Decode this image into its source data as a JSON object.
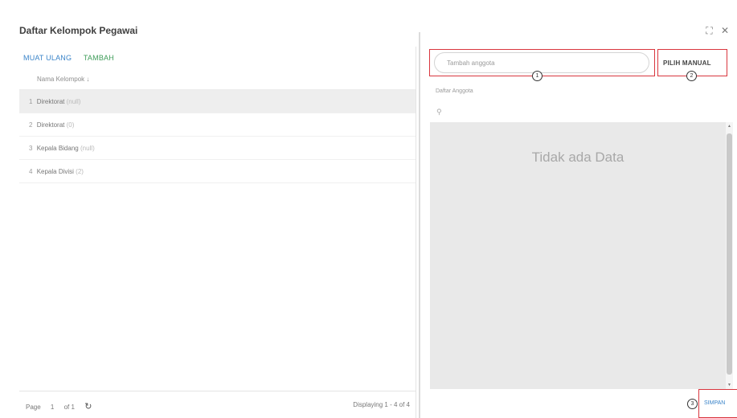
{
  "window": {
    "title": "Daftar Kelompok Pegawai",
    "icons": [
      "maximize-icon",
      "close-icon"
    ],
    "maximize_glyph": "⛶",
    "close_glyph": "✕"
  },
  "left": {
    "toolbar": {
      "reload_label": "MUAT ULANG",
      "add_label": "TAMBAH"
    },
    "column_header": "Nama Kelompok ↓",
    "rows": [
      {
        "index": "1",
        "name": "Direktorat",
        "count": "(null)",
        "selected": true
      },
      {
        "index": "2",
        "name": "Direktorat",
        "count": "(0)",
        "selected": false
      },
      {
        "index": "3",
        "name": "Kepala Bidang",
        "count": "(null)",
        "selected": false
      },
      {
        "index": "4",
        "name": "Kepala Divisi",
        "count": "(2)",
        "selected": false
      }
    ],
    "footer": {
      "page_label": "Page",
      "page_value": "1",
      "of_label": "of 1",
      "refresh_glyph": "↻",
      "displaying": "Displaying 1 - 4 of 4"
    }
  },
  "right": {
    "search_placeholder": "Tambah anggota",
    "pilih_manual_label": "PILIH MANUAL",
    "daftar_label": "Daftar Anggota",
    "search_glyph": "⚲",
    "empty_text": "Tidak ada Data",
    "save_label": "SIMPAN"
  },
  "annotations": [
    "1",
    "2",
    "3"
  ],
  "colors": {
    "highlight": "#d9363e",
    "link": "#3a84c9",
    "add": "#3f9d5a",
    "selected_row": "#eeeeee"
  }
}
